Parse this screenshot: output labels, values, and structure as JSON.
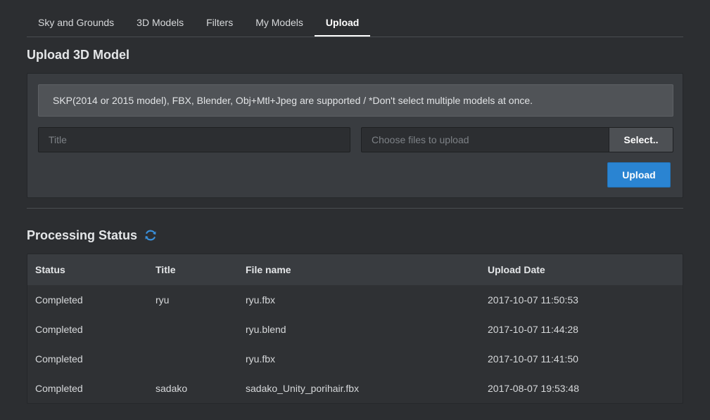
{
  "tabs": [
    {
      "label": "Sky and Grounds",
      "active": false
    },
    {
      "label": "3D Models",
      "active": false
    },
    {
      "label": "Filters",
      "active": false
    },
    {
      "label": "My Models",
      "active": false
    },
    {
      "label": "Upload",
      "active": true
    }
  ],
  "upload": {
    "heading": "Upload 3D Model",
    "notice": "SKP(2014 or 2015 model), FBX, Blender, Obj+Mtl+Jpeg are supported / *Don't select multiple models at once.",
    "title_placeholder": "Title",
    "title_value": "",
    "file_placeholder": "Choose files to upload",
    "file_value": "",
    "select_label": "Select..",
    "upload_label": "Upload"
  },
  "status": {
    "heading": "Processing Status",
    "refresh_icon": "refresh-icon",
    "accent_color": "#3a8fd9",
    "columns": [
      "Status",
      "Title",
      "File name",
      "Upload Date"
    ],
    "rows": [
      {
        "status": "Completed",
        "title": "ryu",
        "file": "ryu.fbx",
        "date": "2017-10-07 11:50:53"
      },
      {
        "status": "Completed",
        "title": "",
        "file": "ryu.blend",
        "date": "2017-10-07 11:44:28"
      },
      {
        "status": "Completed",
        "title": "",
        "file": "ryu.fbx",
        "date": "2017-10-07 11:41:50"
      },
      {
        "status": "Completed",
        "title": "sadako",
        "file": "sadako_Unity_porihair.fbx",
        "date": "2017-08-07 19:53:48"
      }
    ]
  },
  "colors": {
    "background": "#2c2e31",
    "panel": "#393c40",
    "primary_button": "#2a84d2"
  }
}
